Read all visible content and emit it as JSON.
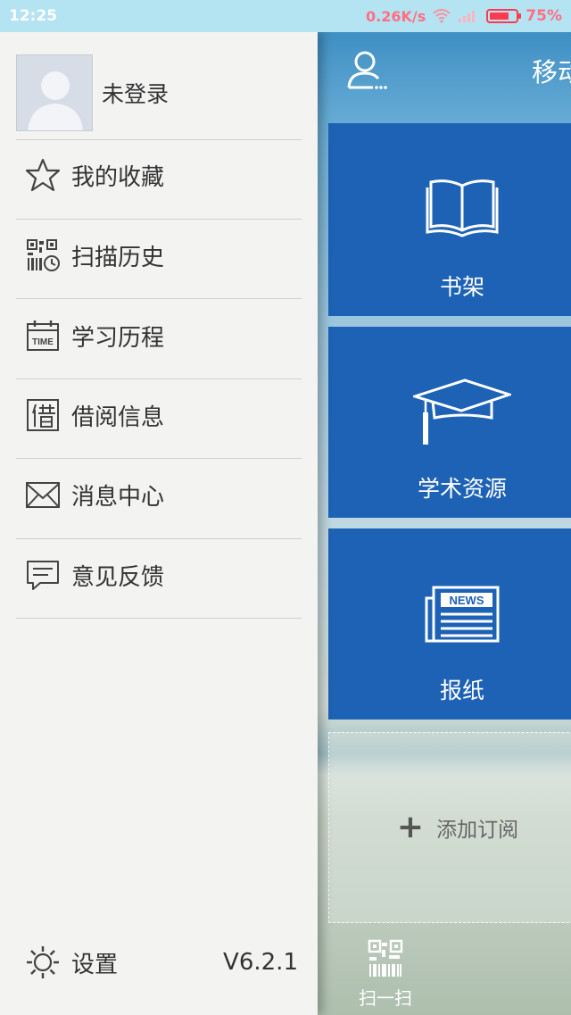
{
  "status_bar": {
    "time": "12:25",
    "network_speed": "0.26K/s",
    "battery_percent": "75%",
    "battery_level": 0.75,
    "accent_color": "#ff3a4f"
  },
  "drawer": {
    "username": "未登录",
    "menu": [
      {
        "label": "我的收藏",
        "icon": "star-icon"
      },
      {
        "label": "扫描历史",
        "icon": "scan-history-icon"
      },
      {
        "label": "学习历程",
        "icon": "time-calendar-icon"
      },
      {
        "label": "借阅信息",
        "icon": "borrow-icon"
      },
      {
        "label": "消息中心",
        "icon": "envelope-icon"
      },
      {
        "label": "意见反馈",
        "icon": "chat-bubble-icon"
      }
    ],
    "settings_label": "设置",
    "version": "V6.2.1"
  },
  "main": {
    "title": "移动",
    "tiles": [
      {
        "label": "书架",
        "icon": "open-book-icon"
      },
      {
        "label": "学术资源",
        "icon": "graduation-cap-icon"
      },
      {
        "label": "报纸",
        "icon": "newspaper-icon",
        "icon_text": "NEWS"
      }
    ],
    "add_subscription_label": "添加订阅",
    "scan_label": "扫一扫",
    "tile_color": "#1e62b5"
  }
}
